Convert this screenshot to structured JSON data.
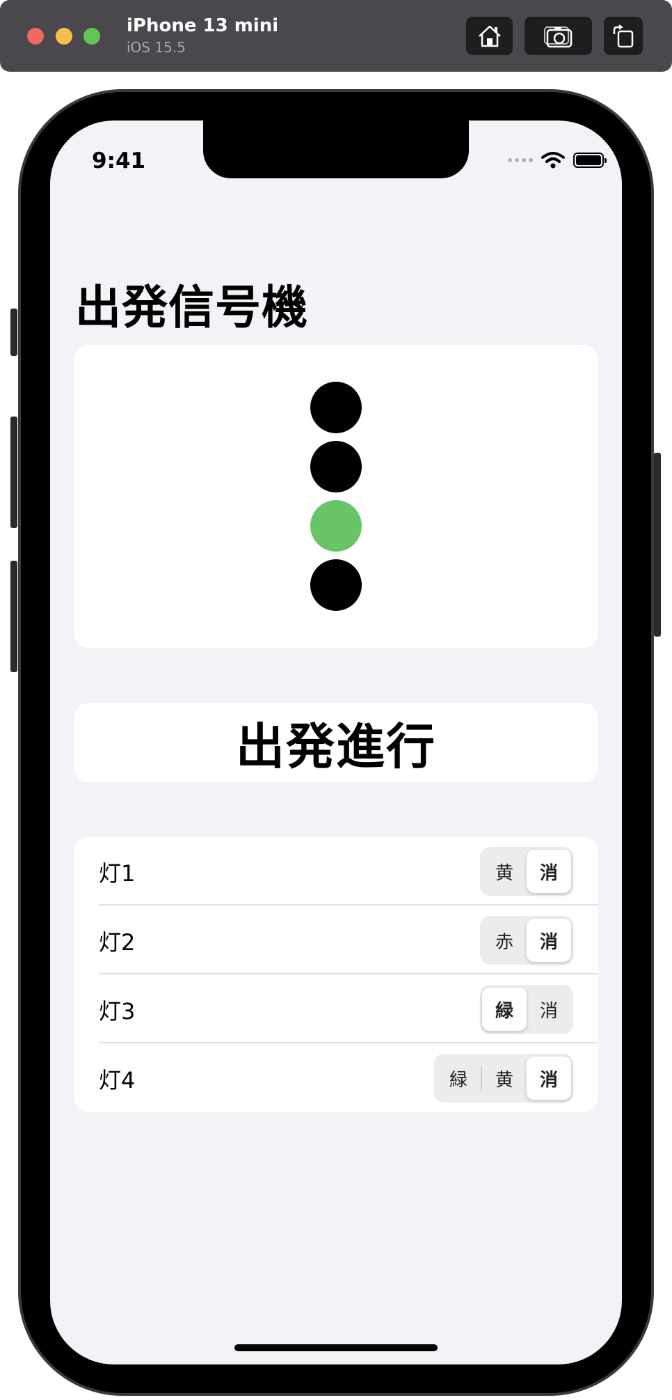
{
  "simulator": {
    "device_name": "iPhone 13 mini",
    "os_version": "iOS 15.5",
    "home_icon": "home-icon",
    "screenshot_icon": "camera-icon",
    "rotate_icon": "rotate-icon"
  },
  "status_bar": {
    "time": "9:41",
    "wifi_icon": "wifi-icon",
    "battery_icon": "battery-icon"
  },
  "page": {
    "title": "出発信号機"
  },
  "signal": {
    "lamps": [
      {
        "state": "off",
        "color": "#000000"
      },
      {
        "state": "off",
        "color": "#000000"
      },
      {
        "state": "green",
        "color": "#67c568"
      },
      {
        "state": "off",
        "color": "#000000"
      }
    ]
  },
  "aspect": {
    "label": "出発進行"
  },
  "controls": {
    "rows": [
      {
        "label": "灯1",
        "options": [
          "黄",
          "消"
        ],
        "selected": "消"
      },
      {
        "label": "灯2",
        "options": [
          "赤",
          "消"
        ],
        "selected": "消"
      },
      {
        "label": "灯3",
        "options": [
          "緑",
          "消"
        ],
        "selected": "緑"
      },
      {
        "label": "灯4",
        "options": [
          "緑",
          "黄",
          "消"
        ],
        "selected": "消"
      }
    ]
  }
}
